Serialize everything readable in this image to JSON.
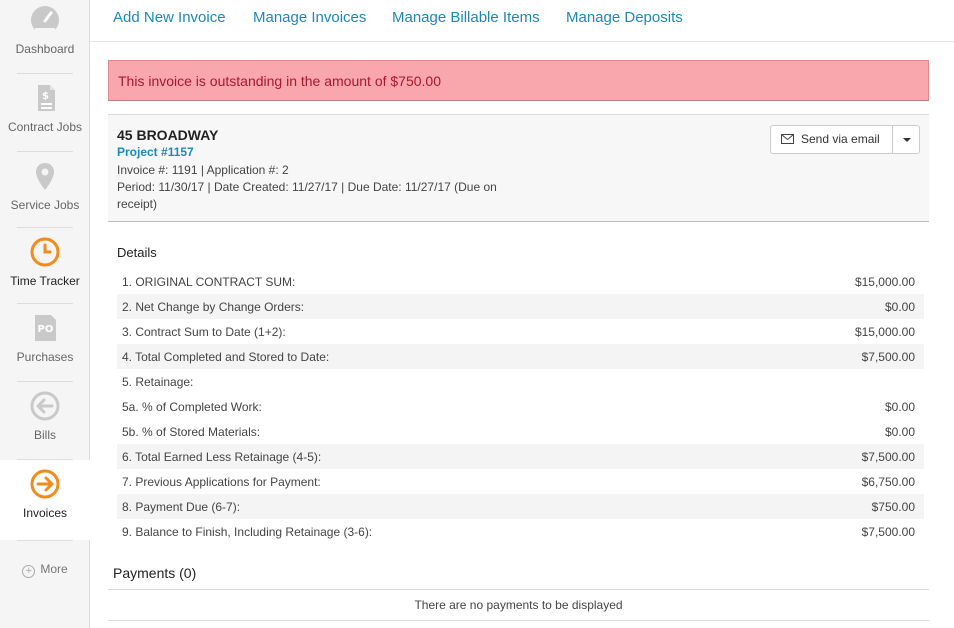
{
  "sidebar": {
    "items": [
      {
        "label": "Dashboard",
        "icon": "dashboard-icon"
      },
      {
        "label": "Contract Jobs",
        "icon": "contract-jobs-icon"
      },
      {
        "label": "Service Jobs",
        "icon": "map-pin-icon"
      },
      {
        "label": "Time Tracker",
        "icon": "clock-icon"
      },
      {
        "label": "Purchases",
        "icon": "po-icon"
      },
      {
        "label": "Bills",
        "icon": "arrow-left-circle-icon"
      },
      {
        "label": "Invoices",
        "icon": "arrow-right-circle-icon"
      }
    ],
    "more_label": "More",
    "accent_color": "#f28a1c",
    "inactive_icon_color": "#c9c9c9"
  },
  "topnav": {
    "links": [
      "Add New Invoice",
      "Manage Invoices",
      "Manage Billable Items",
      "Manage Deposits"
    ]
  },
  "alert": {
    "message": "This invoice is outstanding in the amount of $750.00",
    "background": "#f9a7ad",
    "text_color": "#a8192a"
  },
  "invoice": {
    "title": "45 BROADWAY",
    "project": "Project #1157",
    "numbers": "Invoice #: 1191 | Application #: 2",
    "period_line1": "Period: 11/30/17 | Date Created: 11/27/17 | Due Date: 11/27/17 (Due on",
    "period_line2": "receipt)",
    "send_label": "Send via email"
  },
  "details": {
    "title": "Details",
    "rows": [
      {
        "label": "1. ORIGINAL CONTRACT SUM:",
        "value": "$15,000.00"
      },
      {
        "label": "2. Net Change by Change Orders:",
        "value": "$0.00"
      },
      {
        "label": "3. Contract Sum to Date (1+2):",
        "value": "$15,000.00"
      },
      {
        "label": "4. Total Completed and Stored to Date:",
        "value": "$7,500.00"
      },
      {
        "label": "5. Retainage:",
        "value": ""
      },
      {
        "label": "5a. % of Completed Work:",
        "value": "$0.00"
      },
      {
        "label": "5b. % of Stored Materials:",
        "value": "$0.00"
      },
      {
        "label": "6. Total Earned Less Retainage (4-5):",
        "value": "$7,500.00"
      },
      {
        "label": "7. Previous Applications for Payment:",
        "value": "$6,750.00"
      },
      {
        "label": "8. Payment Due (6-7):",
        "value": "$750.00"
      },
      {
        "label": "9. Balance to Finish, Including Retainage (3-6):",
        "value": "$7,500.00"
      }
    ]
  },
  "payments": {
    "title": "Payments (0)",
    "empty_message": "There are no payments to be displayed"
  }
}
